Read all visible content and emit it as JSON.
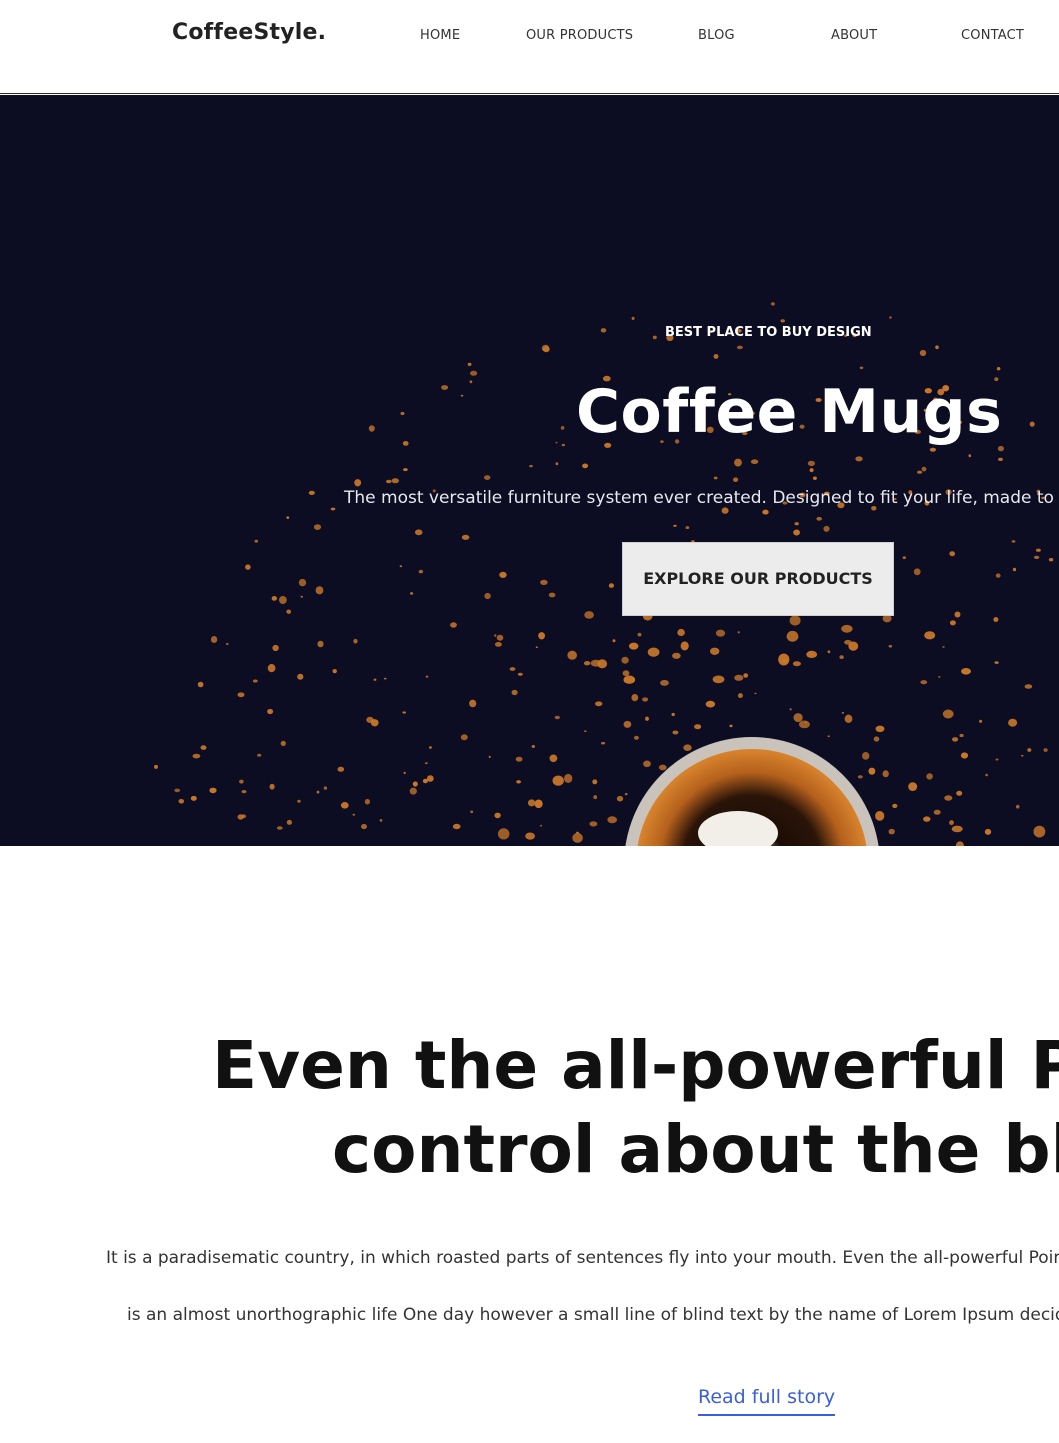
{
  "brand": {
    "logo": "CoffeeStyle."
  },
  "nav": {
    "items": [
      {
        "label": "HOME"
      },
      {
        "label": "OUR PRODUCTS"
      },
      {
        "label": "BLOG"
      },
      {
        "label": "ABOUT"
      },
      {
        "label": "CONTACT"
      }
    ]
  },
  "hero": {
    "eyebrow": "BEST PLACE TO BUY DESIGN",
    "title": "Coffee Mugs",
    "subtitle": "The most versatile furniture system ever created. Designed to fit your life, made to m",
    "cta_label": "EXPLORE OUR PRODUCTS",
    "image": "coffee-cup-with-scattered-coffee-granules",
    "colors": {
      "background": "#0c0c22",
      "granules": "#c8772a"
    }
  },
  "story": {
    "title_line1": "Even the all-powerful Pointin",
    "title_line2": "control about the blind te",
    "paragraph_line1": "It is a paradisematic country, in which roasted parts of sentences fly into your mouth. Even the all-powerful Point",
    "paragraph_line2": "is an almost unorthographic life One day however a small line of blind text by the name of Lorem Ipsum decide",
    "read_more": "Read full story",
    "link_color": "#3a5fd9"
  }
}
